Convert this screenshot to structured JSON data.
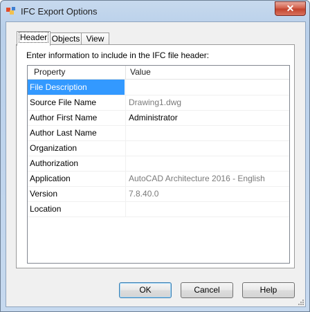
{
  "window": {
    "title": "IFC Export Options",
    "close_label": "✕"
  },
  "tabs": [
    {
      "label": "Header",
      "active": true
    },
    {
      "label": "Objects",
      "active": false
    },
    {
      "label": "View",
      "active": false
    }
  ],
  "header_tab": {
    "instruction": "Enter information to include in the IFC file header:",
    "columns": {
      "property": "Property",
      "value": "Value"
    },
    "rows": [
      {
        "property": "File Description",
        "value": "",
        "selected": true
      },
      {
        "property": "Source File Name",
        "value": "Drawing1.dwg",
        "readonly": true
      },
      {
        "property": "Author First Name",
        "value": "Administrator"
      },
      {
        "property": "Author Last Name",
        "value": ""
      },
      {
        "property": "Organization",
        "value": ""
      },
      {
        "property": "Authorization",
        "value": ""
      },
      {
        "property": "Application",
        "value": "AutoCAD Architecture 2016 - English",
        "readonly": true
      },
      {
        "property": "Version",
        "value": "7.8.40.0",
        "readonly": true
      },
      {
        "property": "Location",
        "value": ""
      }
    ]
  },
  "buttons": {
    "ok": "OK",
    "cancel": "Cancel",
    "help": "Help"
  }
}
